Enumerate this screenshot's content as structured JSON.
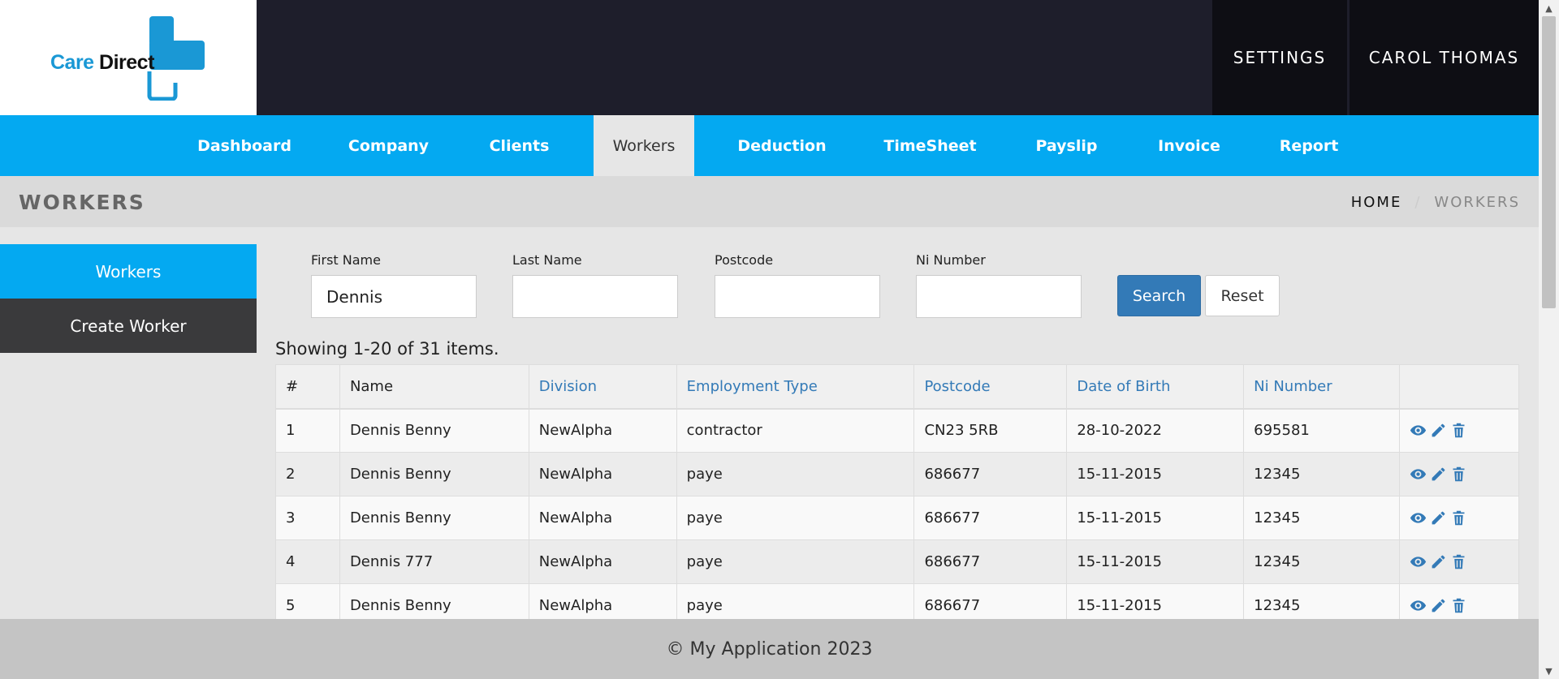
{
  "brand": {
    "word1": "Care",
    "word2": "Direct",
    "primary_color": "#04a9f1",
    "dark_color": "#1e1e2b"
  },
  "top_nav": {
    "settings": "SETTINGS",
    "user": "CAROL THOMAS"
  },
  "main_nav": [
    {
      "label": "Dashboard",
      "active": false
    },
    {
      "label": "Company",
      "active": false
    },
    {
      "label": "Clients",
      "active": false
    },
    {
      "label": "Workers",
      "active": true
    },
    {
      "label": "Deduction",
      "active": false
    },
    {
      "label": "TimeSheet",
      "active": false
    },
    {
      "label": "Payslip",
      "active": false
    },
    {
      "label": "Invoice",
      "active": false
    },
    {
      "label": "Report",
      "active": false
    }
  ],
  "page": {
    "title": "WORKERS"
  },
  "breadcrumb": {
    "home": "HOME",
    "separator": "/",
    "current": "WORKERS"
  },
  "sidebar": {
    "items": [
      {
        "label": "Workers",
        "active": true
      },
      {
        "label": "Create Worker",
        "active": false
      }
    ]
  },
  "search": {
    "first_name_label": "First Name",
    "first_name_value": "Dennis",
    "last_name_label": "Last Name",
    "last_name_value": "",
    "postcode_label": "Postcode",
    "postcode_value": "",
    "ni_label": "Ni Number",
    "ni_value": "",
    "search_button": "Search",
    "reset_button": "Reset"
  },
  "summary": "Showing 1-20 of 31 items.",
  "table": {
    "columns": [
      "#",
      "Name",
      "Division",
      "Employment Type",
      "Postcode",
      "Date of Birth",
      "Ni Number",
      ""
    ],
    "sortable": [
      false,
      false,
      true,
      true,
      true,
      true,
      true,
      false
    ],
    "rows": [
      [
        "1",
        "Dennis Benny",
        "NewAlpha",
        "contractor",
        "CN23 5RB",
        "28-10-2022",
        "695581"
      ],
      [
        "2",
        "Dennis Benny",
        "NewAlpha",
        "paye",
        "686677",
        "15-11-2015",
        "12345"
      ],
      [
        "3",
        "Dennis Benny",
        "NewAlpha",
        "paye",
        "686677",
        "15-11-2015",
        "12345"
      ],
      [
        "4",
        "Dennis 777",
        "NewAlpha",
        "paye",
        "686677",
        "15-11-2015",
        "12345"
      ],
      [
        "5",
        "Dennis Benny",
        "NewAlpha",
        "paye",
        "686677",
        "15-11-2015",
        "12345"
      ]
    ],
    "row_actions": [
      "eye-icon",
      "pencil-icon",
      "trash-icon"
    ]
  },
  "footer": {
    "text": "© My Application 2023"
  }
}
